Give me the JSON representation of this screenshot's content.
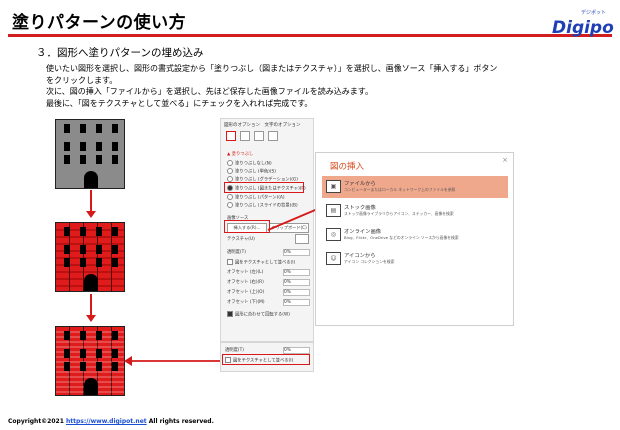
{
  "header": {
    "title": "塗りパターンの使い方",
    "logo_text": "Digipot",
    "logo_sub": "デジポット"
  },
  "section": "３．図形へ塗りパターンの埋め込み",
  "body_lines": [
    "使いたい図形を選択し、図形の書式設定から「塗りつぶし（図またはテクスチャ）」を選択し、画像ソース「挿入する」ボタン",
    "をクリックします。",
    "次に、図の挿入「ファイルから」を選択し、先ほど保存した画像ファイルを読み込みます。",
    "最後に、「図をテクスチャとして並べる」にチェックを入れれば完成です。"
  ],
  "format_pane": {
    "header": "図形のオプション　文字のオプション",
    "fill_section": "▲ 塗りつぶし",
    "options": [
      "塗りつぶしなし(N)",
      "塗りつぶし (単色)(S)",
      "塗りつぶし (グラデーション)(G)",
      "塗りつぶし (図またはテクスチャ)(P)",
      "塗りつぶし (パターン)(A)",
      "塗りつぶし (スライドの背景)(B)"
    ],
    "selected_index": 3,
    "image_source": "画像ソース",
    "insert_button": "挿入する(R)...",
    "clipboard_button": "クリップボード(C)",
    "texture": "テクスチャ(U)",
    "transparency": "透明度(T)",
    "tile_checkbox": "図をテクスチャとして並べる(I)",
    "offsets": [
      "オフセット (左)(L)",
      "オフセット (右)(R)",
      "オフセット (上)(O)",
      "オフセット (下)(M)"
    ],
    "rotate_checkbox": "図形に合わせて回転する(W)",
    "zero": "0%"
  },
  "dialog": {
    "title": "図の挿入",
    "close": "×",
    "items": [
      {
        "title": "ファイルから",
        "sub": "コンピューターまたはローカル ネットワーク上のファイルを参照",
        "icon": "▣"
      },
      {
        "title": "ストック画像",
        "sub": "ストック画像ライブラリからアイコン、ステッカー、画像を検索",
        "icon": "▤"
      },
      {
        "title": "オンライン画像",
        "sub": "Bing、Flickr、OneDrive などのオンライン ソースから画像を検索",
        "icon": "◎"
      },
      {
        "title": "アイコンから",
        "sub": "アイコン コレクションを検索",
        "icon": "☺"
      }
    ]
  },
  "snippet": {
    "transparency": "透明度(T)",
    "tile_checkbox": "図をテクスチャとして並べる(I)",
    "zero": "0%"
  },
  "footer": {
    "copyright": "Copyright©2021 ",
    "link": "https://www.digipot.net",
    "rights": " All rights reserved."
  },
  "colors": {
    "accent": "#d21e1e",
    "castle_gray": "#8b8b8b",
    "brick_red": "#e01b1b",
    "dialog_title": "#d94a1a",
    "selected_item": "#f0a88c",
    "logo_blue": "#1f3fb5"
  }
}
